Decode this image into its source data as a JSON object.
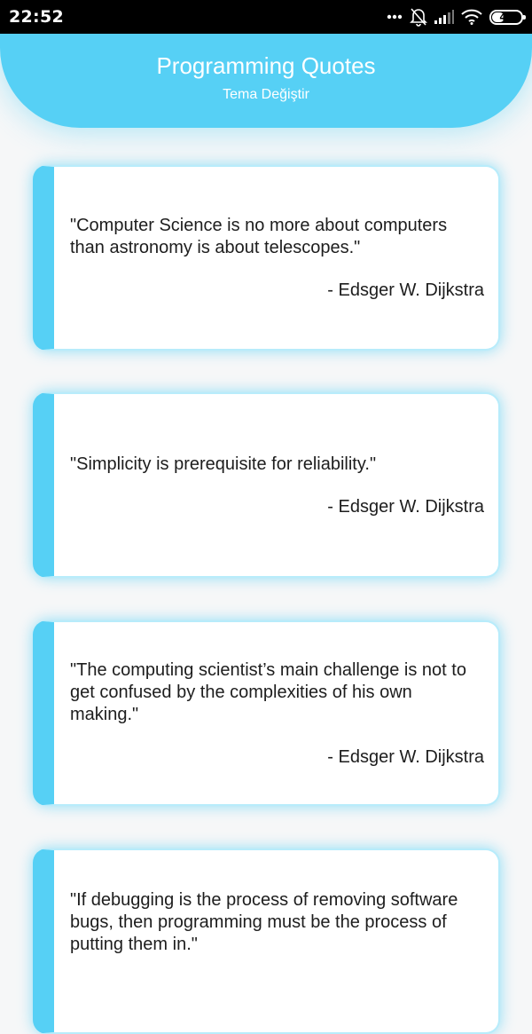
{
  "status_bar": {
    "time": "22:52",
    "battery_level": "44",
    "battery_fraction": 0.44,
    "icons": [
      "more-dots-icon",
      "notifications-off-icon",
      "cellular-signal-icon",
      "wifi-icon",
      "battery-icon"
    ]
  },
  "header": {
    "title": "Programming Quotes",
    "theme_button_label": "Tema Değiştir"
  },
  "colors": {
    "accent": "#56d0f5",
    "background": "#f6f7f8",
    "card": "#ffffff",
    "text": "#1d1d1d"
  },
  "quotes": [
    {
      "text": "\"Computer Science is no more about computers than astronomy is about telescopes.\"",
      "author": "- Edsger W. Dijkstra"
    },
    {
      "text": "\"Simplicity is prerequisite for reliability.\"",
      "author": "- Edsger W. Dijkstra"
    },
    {
      "text": "\"The computing scientist’s main challenge is not to get confused by the complexities of his own making.\"",
      "author": "- Edsger W. Dijkstra"
    },
    {
      "text": "\"If debugging is the process of removing software bugs, then programming must be the process of putting them in.\"",
      "author": ""
    }
  ]
}
